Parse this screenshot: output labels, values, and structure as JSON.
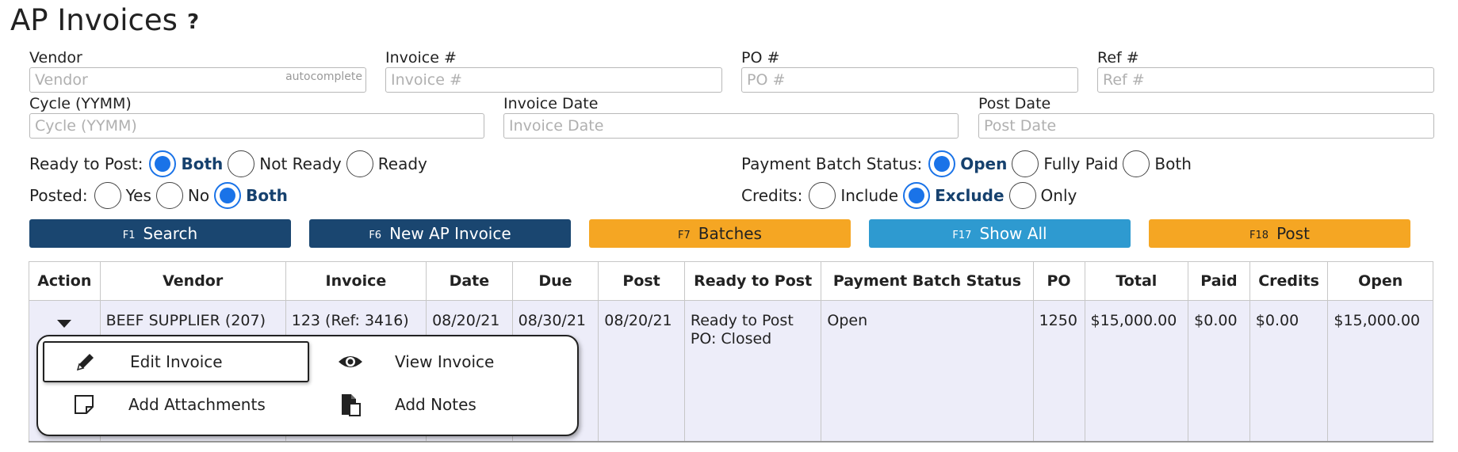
{
  "page": {
    "title": "AP Invoices",
    "help": "?"
  },
  "filters": {
    "vendor": {
      "label": "Vendor",
      "placeholder": "Vendor",
      "hint": "autocomplete",
      "value": ""
    },
    "invoice": {
      "label": "Invoice #",
      "placeholder": "Invoice #",
      "value": ""
    },
    "po": {
      "label": "PO #",
      "placeholder": "PO #",
      "value": ""
    },
    "ref": {
      "label": "Ref #",
      "placeholder": "Ref #",
      "value": ""
    },
    "cycle": {
      "label": "Cycle (YYMM)",
      "placeholder": "Cycle (YYMM)",
      "value": ""
    },
    "invoice_date": {
      "label": "Invoice Date",
      "placeholder": "Invoice Date",
      "value": ""
    },
    "post_date": {
      "label": "Post Date",
      "placeholder": "Post Date",
      "value": ""
    }
  },
  "radios": {
    "ready_to_post": {
      "label": "Ready to Post:",
      "options": [
        "Both",
        "Not Ready",
        "Ready"
      ],
      "selected": "Both"
    },
    "posted": {
      "label": "Posted:",
      "options": [
        "Yes",
        "No",
        "Both"
      ],
      "selected": "Both"
    },
    "payment_batch_status": {
      "label": "Payment Batch Status:",
      "options": [
        "Open",
        "Fully Paid",
        "Both"
      ],
      "selected": "Open"
    },
    "credits": {
      "label": "Credits:",
      "options": [
        "Include",
        "Exclude",
        "Only"
      ],
      "selected": "Exclude"
    }
  },
  "buttons": {
    "search": {
      "key": "F1",
      "label": "Search"
    },
    "new_invoice": {
      "key": "F6",
      "label": "New AP Invoice"
    },
    "batches": {
      "key": "F7",
      "label": "Batches"
    },
    "show_all": {
      "key": "F17",
      "label": "Show All"
    },
    "post": {
      "key": "F18",
      "label": "Post"
    }
  },
  "colors": {
    "navy": "#1a4670",
    "orange": "#f5a623",
    "blue": "#2e9ad0",
    "radio_accent": "#1a73e8",
    "row_bg": "#ededf9"
  },
  "table": {
    "headers": [
      "Action",
      "Vendor",
      "Invoice",
      "Date",
      "Due",
      "Post",
      "Ready to Post",
      "Payment Batch Status",
      "PO",
      "Total",
      "Paid",
      "Credits",
      "Open"
    ],
    "rows": [
      {
        "vendor": "BEEF SUPPLIER (207)",
        "invoice": "123 (Ref: 3416)",
        "date": "08/20/21",
        "due": "08/30/21",
        "post": "08/20/21",
        "ready_line1": "Ready to Post",
        "ready_line2": "PO: Closed",
        "payment_batch_status": "Open",
        "po": "1250",
        "total": "$15,000.00",
        "paid": "$0.00",
        "credits": "$0.00",
        "open": "$15,000.00"
      }
    ]
  },
  "action_menu": {
    "items": [
      {
        "label": "Edit Invoice",
        "icon": "pencil-icon"
      },
      {
        "label": "View Invoice",
        "icon": "eye-icon"
      },
      {
        "label": "Add Attachments",
        "icon": "attachment-icon"
      },
      {
        "label": "Add Notes",
        "icon": "notes-icon"
      }
    ]
  }
}
